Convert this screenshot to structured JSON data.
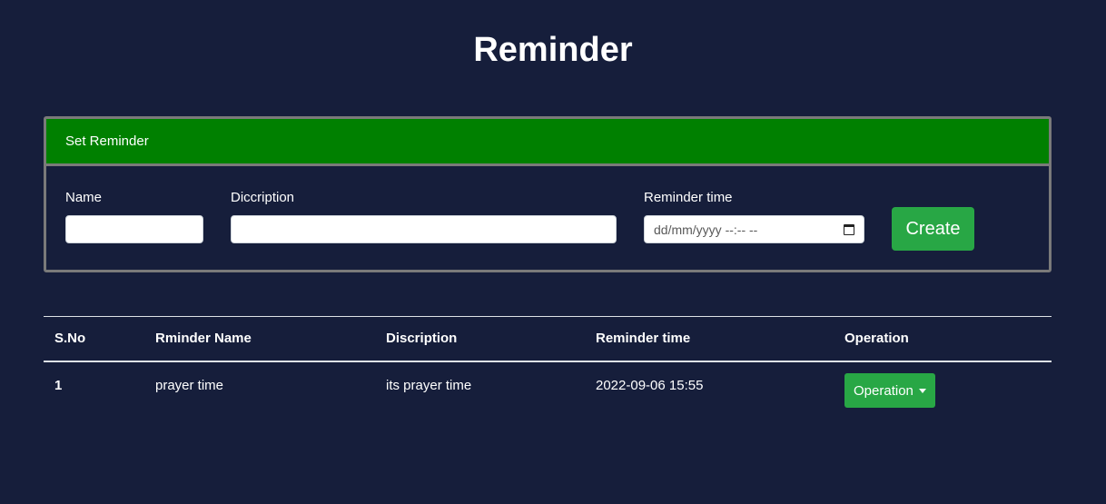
{
  "page": {
    "title": "Reminder"
  },
  "form": {
    "header": "Set Reminder",
    "name_label": "Name",
    "name_value": "",
    "description_label": "Diccription",
    "description_value": "",
    "time_label": "Reminder time",
    "time_placeholder": "dd/mm/yyyy --:-- --",
    "calendar_icon": "calendar-icon",
    "create_label": "Create"
  },
  "table": {
    "headers": [
      "S.No",
      "Rminder Name",
      "Discription",
      "Reminder time",
      "Operation"
    ],
    "rows": [
      {
        "sno": "1",
        "name": "prayer time",
        "description": "its prayer time",
        "time": "2022-09-06 15:55",
        "operation_label": "Operation"
      }
    ]
  },
  "colors": {
    "background": "#161e3b",
    "header_green": "#008000",
    "button_green": "#28a745",
    "card_border": "#7a7a7a"
  }
}
